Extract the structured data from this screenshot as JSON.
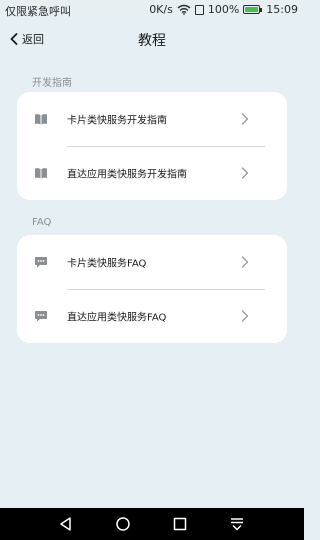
{
  "status_bar": {
    "carrier": "仅限紧急呼叫",
    "network_speed": "0K/s",
    "battery_percent": "100%",
    "time": "15:09"
  },
  "header": {
    "back_label": "返回",
    "title": "教程"
  },
  "sections": [
    {
      "label": "开发指南",
      "items": [
        {
          "label": "卡片类快服务开发指南",
          "icon": "book-icon"
        },
        {
          "label": "直达应用类快服务开发指南",
          "icon": "book-icon"
        }
      ]
    },
    {
      "label": "FAQ",
      "items": [
        {
          "label": "卡片类快服务FAQ",
          "icon": "chat-bubble-icon"
        },
        {
          "label": "直达应用类快服务FAQ",
          "icon": "chat-bubble-icon"
        }
      ]
    }
  ],
  "colors": {
    "background": "#e6eff4",
    "card": "#ffffff",
    "battery_fill": "#42c04a",
    "section_label": "#8a8f93"
  },
  "nav_bar": {
    "icons": [
      "back-triangle-icon",
      "home-circle-icon",
      "recents-square-icon",
      "notification-pull-icon"
    ]
  }
}
